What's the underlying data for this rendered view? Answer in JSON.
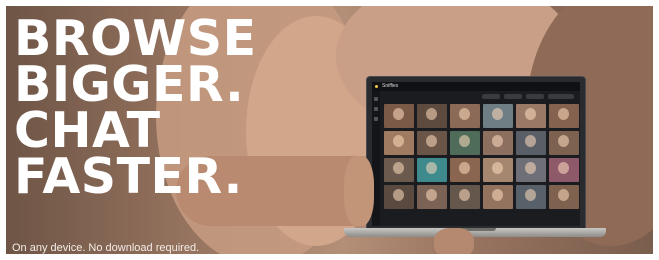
{
  "headline": {
    "line1": "BROWSE",
    "line2": "BIGGER.",
    "line3": "CHAT",
    "line4": "FASTER."
  },
  "subtext": "On any device. No download required.",
  "laptop": {
    "app_title": "Sniffies"
  },
  "colors": {
    "headline": "#ffffff",
    "accent": "#f2c744",
    "screen_bg": "#1b1c20"
  }
}
